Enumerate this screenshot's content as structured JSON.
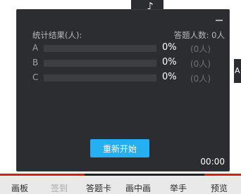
{
  "background": {
    "music_icon": "music-note-icon",
    "right_tab_label": "A"
  },
  "panel": {
    "title_left": "统计结果(人):",
    "respondents_label": "答题人数: 0人",
    "options": [
      {
        "label": "A",
        "percent": "0%",
        "count": "(0人)",
        "fraction": 0
      },
      {
        "label": "B",
        "percent": "0%",
        "count": "(0人)",
        "fraction": 0
      },
      {
        "label": "C",
        "percent": "0%",
        "count": "(0人)",
        "fraction": 0
      }
    ],
    "restart_label": "重新开始",
    "timer": "00:00",
    "accent_color": "#25aef0"
  },
  "toolbar": {
    "items": [
      {
        "label": "画板",
        "enabled": true
      },
      {
        "label": "签到",
        "enabled": false
      },
      {
        "label": "答题卡",
        "enabled": true
      },
      {
        "label": "画中画",
        "enabled": true
      },
      {
        "label": "举手",
        "enabled": true
      },
      {
        "label": "预览",
        "enabled": true
      }
    ]
  }
}
